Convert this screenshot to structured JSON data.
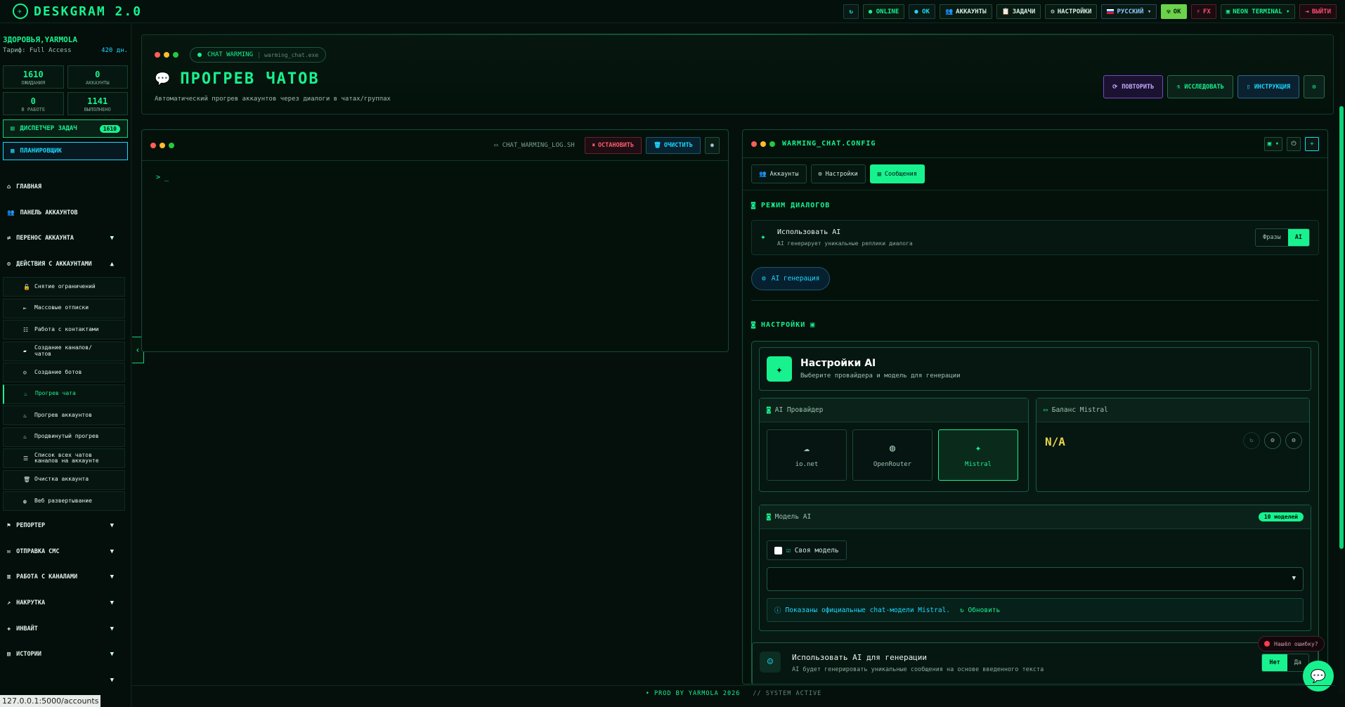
{
  "topbar": {
    "brand": "DESKGRAM 2.0",
    "buttons": [
      {
        "name": "refresh",
        "label": "↻"
      },
      {
        "name": "online",
        "label": "● ONLINE"
      },
      {
        "name": "ok-status",
        "label": "● OK"
      },
      {
        "name": "accounts",
        "label": "АККАУНТЫ"
      },
      {
        "name": "tasks",
        "label": "ЗАДАЧИ"
      },
      {
        "name": "settings",
        "label": "НАСТРОЙКИ"
      },
      {
        "name": "language",
        "label": "РУССКИЙ ▾"
      },
      {
        "name": "ok",
        "label": "OK"
      },
      {
        "name": "fx",
        "label": "FX"
      },
      {
        "name": "theme",
        "label": "NEON TERMINAL ▾"
      },
      {
        "name": "logout",
        "label": "ВЫЙТИ"
      }
    ]
  },
  "sidebar": {
    "greeting": "ЗДОРОВЬЯ,YARMOLA",
    "plan": "Тариф: Full Access",
    "days": "420 дн.",
    "stats": [
      {
        "value": "1610",
        "label": "ОЖИДАНИЯ"
      },
      {
        "value": "0",
        "label": "АККАУНТЫ"
      },
      {
        "value": "0",
        "label": "В РАБОТЕ"
      },
      {
        "value": "1141",
        "label": "ВЫПОЛНЕНО"
      }
    ],
    "dispatcher": {
      "label": "ДИСПЕТЧЕР ЗАДАЧ",
      "count": "1610"
    },
    "scheduler": "ПЛАНИРОВЩИК",
    "menu": [
      {
        "label": "ГЛАВНАЯ",
        "icon": "home-icon"
      },
      {
        "label": "ПАНЕЛЬ АККАУНТОВ",
        "icon": "users-icon"
      },
      {
        "label": "ПЕРЕНОС АККАУНТА",
        "icon": "user-transfer-icon",
        "chev": "▼"
      },
      {
        "label": "ДЕЙСТВИЯ С АККАУНТАМИ",
        "icon": "user-gear-icon",
        "chev": "▲"
      }
    ],
    "submenu": [
      {
        "label": "Снятие ограничений",
        "icon": "unlock-icon"
      },
      {
        "label": "Массовые отписки",
        "icon": "logout-icon"
      },
      {
        "label": "Работа с контактами",
        "icon": "contacts-icon"
      },
      {
        "label": "Создание каналов/чатов",
        "icon": "chat-icon"
      },
      {
        "label": "Создание ботов",
        "icon": "robot-icon"
      },
      {
        "label": "Прогрев чата",
        "icon": "fire-icon",
        "active": true
      },
      {
        "label": "Прогрев аккаунтов",
        "icon": "fire-icon"
      },
      {
        "label": "Продвинутый прогрев",
        "icon": "fire-icon"
      },
      {
        "label": "Список всех чатов каналов на аккаунте",
        "icon": "list-icon"
      },
      {
        "label": "Очистка аккаунта",
        "icon": "trash-icon"
      },
      {
        "label": "Веб развертывание",
        "icon": "globe-icon"
      }
    ],
    "menu2": [
      {
        "label": "РЕПОРТЕР",
        "icon": "flag-icon",
        "chev": "▼"
      },
      {
        "label": "ОТПРАВКА СМС",
        "icon": "message-icon",
        "chev": "▼"
      },
      {
        "label": "РАБОТА С КАНАЛАМИ",
        "icon": "building-icon",
        "chev": "▼"
      },
      {
        "label": "НАКРУТКА",
        "icon": "chart-icon",
        "chev": "▼"
      },
      {
        "label": "ИНВАЙТ",
        "icon": "user-plus-icon",
        "chev": "▼"
      },
      {
        "label": "ИСТОРИИ",
        "icon": "film-icon",
        "chev": "▼"
      },
      {
        "label": "",
        "icon": "",
        "chev": "▼"
      }
    ],
    "status_url": "127.0.0.1:5000/accounts"
  },
  "header": {
    "tag": "CHAT WARMING",
    "tag_file": "warming_chat.exe",
    "title": "ПРОГРЕВ ЧАТОВ",
    "subtitle": "Автоматический прогрев аккаунтов через диалоги в чатах/группах",
    "buttons": {
      "repeat": "ПОВТОРИТЬ",
      "explore": "ИССЛЕДОВАТЬ",
      "instruction": "ИНСТРУКЦИЯ"
    }
  },
  "terminal": {
    "file": "CHAT_WARMING_LOG.SH",
    "stop": "ОСТАНОВИТЬ",
    "clear": "ОЧИСТИТЬ",
    "prompt": "> _"
  },
  "config": {
    "title": "WARMING_CHAT.CONFIG",
    "tabs": [
      "Аккаунты",
      "Настройки",
      "Сообщения"
    ],
    "dialog_mode": "РЕЖИМ ДИАЛОГОВ",
    "use_ai": {
      "title": "Использовать AI",
      "desc": "AI генерирует уникальные реплики диалога",
      "opt1": "Фразы",
      "opt2": "AI"
    },
    "ai_gen": "AI генерация",
    "settings_title": "НАСТРОЙКИ",
    "ai_settings": {
      "title": "Настройки AI",
      "desc": "Выберите провайдера и модель для генерации"
    },
    "provider": {
      "title": "AI Провайдер",
      "options": [
        "io.net",
        "OpenRouter",
        "Mistral"
      ]
    },
    "balance": {
      "title": "Баланс Mistral",
      "value": "N/A"
    },
    "model": {
      "title": "Модель AI",
      "badge": "10 моделей",
      "own": "Своя модель",
      "info": "Показаны официальные chat-модели Mistral.",
      "refresh": "Обновить"
    },
    "use_ai_gen": {
      "title": "Использовать AI для генерации",
      "desc": "AI будет генерировать уникальные сообщения на основе введенного текста",
      "no": "Нет",
      "yes": "Да"
    }
  },
  "bug": "Нашёл ошибку?",
  "footer": {
    "prod": "• PROD BY YARMOLA 2026",
    "sys": "// SYSTEM ACTIVE"
  }
}
